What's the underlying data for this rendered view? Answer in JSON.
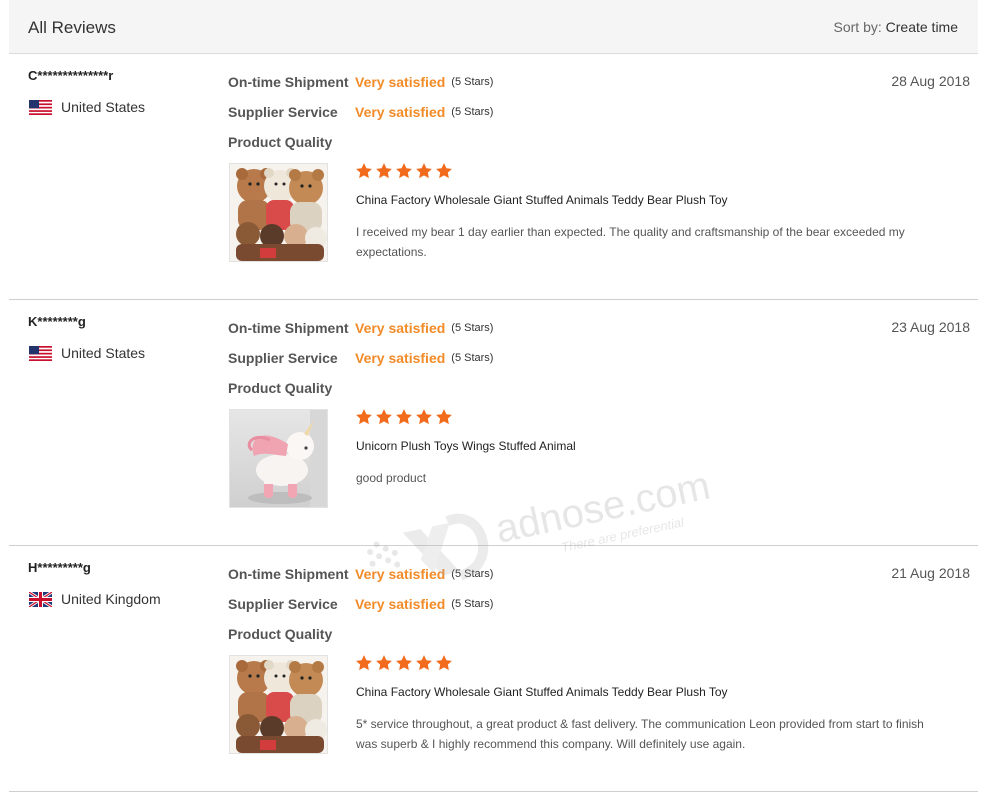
{
  "header": {
    "title": "All Reviews",
    "sort_prefix": "Sort by:",
    "sort_value": "Create time"
  },
  "labels": {
    "shipment": "On-time Shipment",
    "service": "Supplier Service",
    "quality": "Product Quality"
  },
  "reviews": [
    {
      "user": "C**************r",
      "country": "United States",
      "flag": "us",
      "date": "28 Aug 2018",
      "shipment_rating": "Very satisfied",
      "shipment_stars": "(5 Stars)",
      "service_rating": "Very satisfied",
      "service_stars": "(5 Stars)",
      "quality_stars": 5,
      "product": "China Factory Wholesale Giant Stuffed Animals Teddy Bear Plush Toy",
      "comment": "I received my bear 1 day earlier than expected. The quality and craftsmanship of the bear exceeded my expectations.",
      "image": "teddy-bears-image"
    },
    {
      "user": "K********g",
      "country": "United States",
      "flag": "us",
      "date": "23 Aug 2018",
      "shipment_rating": "Very satisfied",
      "shipment_stars": "(5 Stars)",
      "service_rating": "Very satisfied",
      "service_stars": "(5 Stars)",
      "quality_stars": 5,
      "product": "Unicorn Plush Toys Wings Stuffed Animal",
      "comment": "good product",
      "image": "unicorn-plush-image"
    },
    {
      "user": "H*********g",
      "country": "United Kingdom",
      "flag": "uk",
      "date": "21 Aug 2018",
      "shipment_rating": "Very satisfied",
      "shipment_stars": "(5 Stars)",
      "service_rating": "Very satisfied",
      "service_stars": "(5 Stars)",
      "quality_stars": 5,
      "product": "China Factory Wholesale Giant Stuffed Animals Teddy Bear Plush Toy",
      "comment": "5* service throughout, a great product & fast delivery. The communication Leon provided from start to finish was superb & I highly recommend this company. Will definitely use again.",
      "image": "teddy-bears-image"
    }
  ],
  "watermark": {
    "brand": "adnose.com",
    "tagline": "There are preferential"
  },
  "colors": {
    "accent": "#f28b28",
    "star": "#f26a1b",
    "divider": "#cfcfcf"
  }
}
